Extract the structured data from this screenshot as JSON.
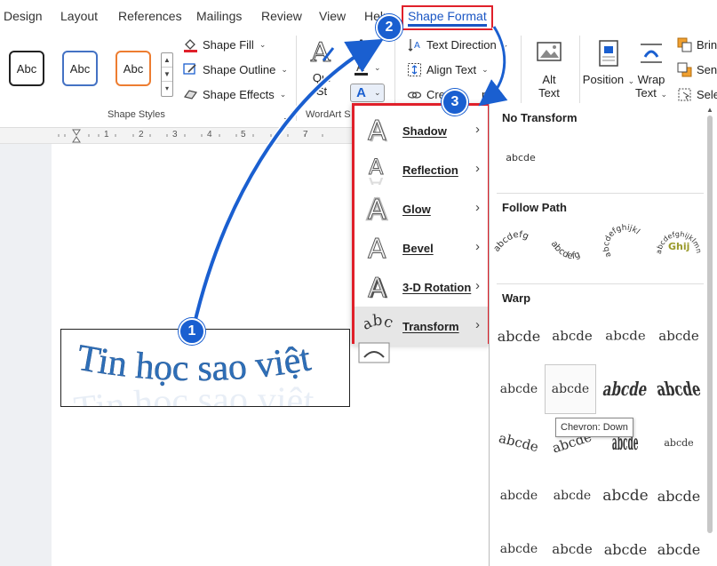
{
  "tabs": [
    "Design",
    "Layout",
    "References",
    "Mailings",
    "Review",
    "View",
    "Help",
    "Shape Format"
  ],
  "active_tab": "Shape Format",
  "ribbon": {
    "shape_styles": {
      "swatch_label": "Abc",
      "swatch_colors": [
        "#222222",
        "#4472c4",
        "#ed7d31"
      ],
      "group_label": "Shape Styles"
    },
    "shape_fill": "Shape Fill",
    "shape_outline": "Shape Outline",
    "shape_effects": "Shape Effects",
    "quick_styles": {
      "line1": "Qui",
      "line2": "St"
    },
    "wordart_styles_label": "WordArt S",
    "text_direction": "Text Direction",
    "align_text": "Align Text",
    "create_link": "Cre",
    "link_suffix": "nk",
    "alt_text": {
      "line1": "Alt",
      "line2": "Text"
    },
    "position": "Position",
    "wrap_text": {
      "line1": "Wrap",
      "line2": "Text"
    },
    "bring_forward": "Bring",
    "send_backward": "Send",
    "selection_pane": "Sele"
  },
  "ruler_numbers": [
    "1",
    "2",
    "3",
    "4",
    "5",
    "6",
    "7"
  ],
  "document": {
    "wordart_text": "Tin học sao việt",
    "wordart_color": "#2e6fb8"
  },
  "effects_menu": [
    {
      "label": "Shadow",
      "icon": "shadow-a-icon"
    },
    {
      "label": "Reflection",
      "icon": "reflection-a-icon"
    },
    {
      "label": "Glow",
      "icon": "glow-a-icon"
    },
    {
      "label": "Bevel",
      "icon": "bevel-a-icon"
    },
    {
      "label": "3-D Rotation",
      "icon": "3d-rotation-a-icon"
    },
    {
      "label": "Transform",
      "icon": "abc-transform-icon"
    }
  ],
  "transform_gallery": {
    "no_transform_heading": "No Transform",
    "no_transform_sample": "abcde",
    "follow_path_heading": "Follow Path",
    "follow_path_samples": [
      "abcdefg",
      "abcdefg",
      "abcdefghijkl",
      "abcdefghijklmnop"
    ],
    "warp_heading": "Warp",
    "warp_sample": "abcde"
  },
  "tooltip": "Chevron: Down",
  "step_badges": [
    "1",
    "2",
    "3"
  ],
  "accent_color": "#1a5fd0",
  "highlight_color": "#e0202a"
}
